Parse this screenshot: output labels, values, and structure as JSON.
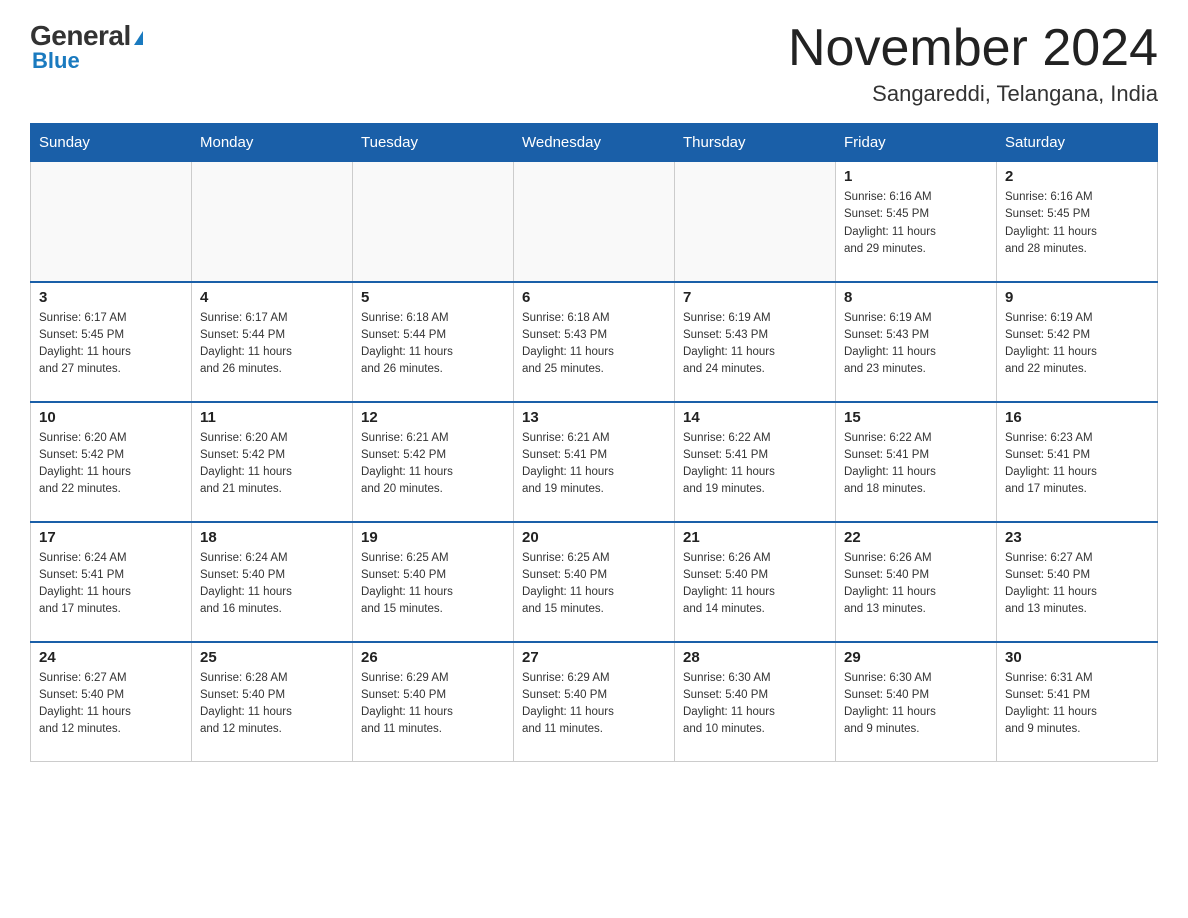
{
  "logo": {
    "general": "General",
    "blue": "Blue",
    "arrow_char": "▶"
  },
  "title": "November 2024",
  "location": "Sangareddi, Telangana, India",
  "days_of_week": [
    "Sunday",
    "Monday",
    "Tuesday",
    "Wednesday",
    "Thursday",
    "Friday",
    "Saturday"
  ],
  "weeks": [
    [
      {
        "day": "",
        "info": ""
      },
      {
        "day": "",
        "info": ""
      },
      {
        "day": "",
        "info": ""
      },
      {
        "day": "",
        "info": ""
      },
      {
        "day": "",
        "info": ""
      },
      {
        "day": "1",
        "info": "Sunrise: 6:16 AM\nSunset: 5:45 PM\nDaylight: 11 hours\nand 29 minutes."
      },
      {
        "day": "2",
        "info": "Sunrise: 6:16 AM\nSunset: 5:45 PM\nDaylight: 11 hours\nand 28 minutes."
      }
    ],
    [
      {
        "day": "3",
        "info": "Sunrise: 6:17 AM\nSunset: 5:45 PM\nDaylight: 11 hours\nand 27 minutes."
      },
      {
        "day": "4",
        "info": "Sunrise: 6:17 AM\nSunset: 5:44 PM\nDaylight: 11 hours\nand 26 minutes."
      },
      {
        "day": "5",
        "info": "Sunrise: 6:18 AM\nSunset: 5:44 PM\nDaylight: 11 hours\nand 26 minutes."
      },
      {
        "day": "6",
        "info": "Sunrise: 6:18 AM\nSunset: 5:43 PM\nDaylight: 11 hours\nand 25 minutes."
      },
      {
        "day": "7",
        "info": "Sunrise: 6:19 AM\nSunset: 5:43 PM\nDaylight: 11 hours\nand 24 minutes."
      },
      {
        "day": "8",
        "info": "Sunrise: 6:19 AM\nSunset: 5:43 PM\nDaylight: 11 hours\nand 23 minutes."
      },
      {
        "day": "9",
        "info": "Sunrise: 6:19 AM\nSunset: 5:42 PM\nDaylight: 11 hours\nand 22 minutes."
      }
    ],
    [
      {
        "day": "10",
        "info": "Sunrise: 6:20 AM\nSunset: 5:42 PM\nDaylight: 11 hours\nand 22 minutes."
      },
      {
        "day": "11",
        "info": "Sunrise: 6:20 AM\nSunset: 5:42 PM\nDaylight: 11 hours\nand 21 minutes."
      },
      {
        "day": "12",
        "info": "Sunrise: 6:21 AM\nSunset: 5:42 PM\nDaylight: 11 hours\nand 20 minutes."
      },
      {
        "day": "13",
        "info": "Sunrise: 6:21 AM\nSunset: 5:41 PM\nDaylight: 11 hours\nand 19 minutes."
      },
      {
        "day": "14",
        "info": "Sunrise: 6:22 AM\nSunset: 5:41 PM\nDaylight: 11 hours\nand 19 minutes."
      },
      {
        "day": "15",
        "info": "Sunrise: 6:22 AM\nSunset: 5:41 PM\nDaylight: 11 hours\nand 18 minutes."
      },
      {
        "day": "16",
        "info": "Sunrise: 6:23 AM\nSunset: 5:41 PM\nDaylight: 11 hours\nand 17 minutes."
      }
    ],
    [
      {
        "day": "17",
        "info": "Sunrise: 6:24 AM\nSunset: 5:41 PM\nDaylight: 11 hours\nand 17 minutes."
      },
      {
        "day": "18",
        "info": "Sunrise: 6:24 AM\nSunset: 5:40 PM\nDaylight: 11 hours\nand 16 minutes."
      },
      {
        "day": "19",
        "info": "Sunrise: 6:25 AM\nSunset: 5:40 PM\nDaylight: 11 hours\nand 15 minutes."
      },
      {
        "day": "20",
        "info": "Sunrise: 6:25 AM\nSunset: 5:40 PM\nDaylight: 11 hours\nand 15 minutes."
      },
      {
        "day": "21",
        "info": "Sunrise: 6:26 AM\nSunset: 5:40 PM\nDaylight: 11 hours\nand 14 minutes."
      },
      {
        "day": "22",
        "info": "Sunrise: 6:26 AM\nSunset: 5:40 PM\nDaylight: 11 hours\nand 13 minutes."
      },
      {
        "day": "23",
        "info": "Sunrise: 6:27 AM\nSunset: 5:40 PM\nDaylight: 11 hours\nand 13 minutes."
      }
    ],
    [
      {
        "day": "24",
        "info": "Sunrise: 6:27 AM\nSunset: 5:40 PM\nDaylight: 11 hours\nand 12 minutes."
      },
      {
        "day": "25",
        "info": "Sunrise: 6:28 AM\nSunset: 5:40 PM\nDaylight: 11 hours\nand 12 minutes."
      },
      {
        "day": "26",
        "info": "Sunrise: 6:29 AM\nSunset: 5:40 PM\nDaylight: 11 hours\nand 11 minutes."
      },
      {
        "day": "27",
        "info": "Sunrise: 6:29 AM\nSunset: 5:40 PM\nDaylight: 11 hours\nand 11 minutes."
      },
      {
        "day": "28",
        "info": "Sunrise: 6:30 AM\nSunset: 5:40 PM\nDaylight: 11 hours\nand 10 minutes."
      },
      {
        "day": "29",
        "info": "Sunrise: 6:30 AM\nSunset: 5:40 PM\nDaylight: 11 hours\nand 9 minutes."
      },
      {
        "day": "30",
        "info": "Sunrise: 6:31 AM\nSunset: 5:41 PM\nDaylight: 11 hours\nand 9 minutes."
      }
    ]
  ]
}
